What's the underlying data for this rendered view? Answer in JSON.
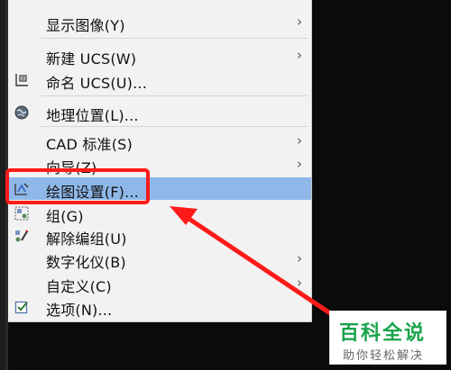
{
  "menu": {
    "items": [
      {
        "label": "显示图像(Y)",
        "icon": "",
        "submenu": true
      },
      {
        "label": "新建 UCS(W)",
        "icon": "",
        "submenu": true
      },
      {
        "label": "命名 UCS(U)...",
        "icon": "named-ucs-icon",
        "submenu": false
      },
      {
        "label": "地理位置(L)...",
        "icon": "globe-icon",
        "submenu": false
      },
      {
        "label": "CAD 标准(S)",
        "icon": "",
        "submenu": true
      },
      {
        "label": "向导(Z)",
        "icon": "",
        "submenu": true
      },
      {
        "label": "绘图设置(F)...",
        "icon": "drafting-settings-icon",
        "submenu": false
      },
      {
        "label": "组(G)",
        "icon": "group-icon",
        "submenu": false
      },
      {
        "label": "解除编组(U)",
        "icon": "ungroup-icon",
        "submenu": false
      },
      {
        "label": "数字化仪(B)",
        "icon": "",
        "submenu": true
      },
      {
        "label": "自定义(C)",
        "icon": "",
        "submenu": true
      },
      {
        "label": "选项(N)...",
        "icon": "options-checkbox-icon",
        "submenu": false
      }
    ],
    "arrow": "›",
    "highlight_color": "#8fb8e8"
  },
  "annotation": {
    "box_color": "#ff1a1a"
  },
  "watermark": {
    "title": "百科全说",
    "subtitle": "助你轻松解决",
    "color": "#1aa34a"
  }
}
